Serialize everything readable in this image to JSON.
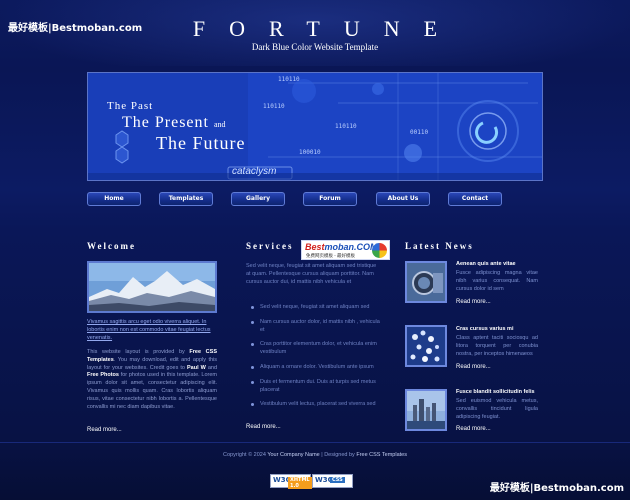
{
  "watermark": {
    "top_left": "最好模板|Bestmoban.com",
    "bottom_right": "最好模板|Bestmoban.com"
  },
  "header": {
    "title": "FORTUNE",
    "tagline": "Dark Blue Color Website Template"
  },
  "banner": {
    "line1": "The Past",
    "line2": "The Present",
    "line2_suffix": "and",
    "line3": "The Future",
    "brand": "cataclysm",
    "binary": [
      "110110",
      "110110",
      "100010",
      "00110",
      "110110"
    ]
  },
  "nav": {
    "items": [
      {
        "label": "Home",
        "active": true
      },
      {
        "label": "Templates"
      },
      {
        "label": "Gallery"
      },
      {
        "label": "Forum"
      },
      {
        "label": "About Us"
      },
      {
        "label": "Contact"
      }
    ]
  },
  "welcome": {
    "heading": "Welcome",
    "caption": "Vivamus sagittis arcu eget odio viverra aliquet. In lobortis enim non est commodo vitae feugiat lectus venenatis.",
    "body_intro": "This website layout is provided by",
    "body_link1": "Free CSS Templates",
    "body_mid1": ". You may download, edit and apply this layout for your websites. Credit goes to",
    "body_link2": "Paul W",
    "body_mid2": "and",
    "body_link3": "Free Photos",
    "body_end": "for photos used in this template. Lorem ipsum dolor sit amet, consectetur adipiscing elit. Vivamus quis mollis quam. Cras lobortis aliquam risus, vitae consectetur nibh lobortis a. Pellentesque convallis mi nec diam dapibus vitae.",
    "read_more": "Read more..."
  },
  "services": {
    "heading": "Services",
    "logo_brand_a": "Best",
    "logo_brand_b": "moban.COM",
    "logo_sub": "免费网页模板 - 最好模板",
    "intro": "Sed velit neque, feugiat sit amet aliquam sed tristique at quam. Pellentesque cursus aliquam porttitor. Nam cursus auctor dui, id mattis nibh vehicula et",
    "items": [
      "Sed velit neque, feugiat sit amet aliquam sed",
      "Nam cursus auctor dolor, id mattis nibh , vehicula et",
      "Cras porttitor elementum dolor, et vehicula enim vestibulum",
      "Aliquam a ornare dolor. Vestibulum ante ipsum",
      "Duis et fermentum dui. Duis at turpis sed metus placerat",
      "Vestibulum velit lectus, placerat sed viverra sed"
    ],
    "read_more": "Read more..."
  },
  "news": {
    "heading": "Latest News",
    "items": [
      {
        "title": "Aenean quis ante vitae",
        "body": "Fusce adipiscing magna vitae nibh varius consequat. Nam cursus dolor id sem",
        "read_more": "Read more..."
      },
      {
        "title": "Cras cursus varius mi",
        "body": "Class aptent taciti sociosqu ad litora torquent per conubia nostra, per inceptos himenaeos",
        "read_more": "Read more..."
      },
      {
        "title": "Fusce blandit sollicitudin felis",
        "body": "Sed euismod vehicula metus, convallis tincidunt ligula adipiscing feugiat.",
        "read_more": "Read more..."
      }
    ]
  },
  "footer": {
    "prefix": "Copyright © 2024",
    "company": "Your Company Name",
    "sep": "| Designed by",
    "designer": "Free CSS Templates",
    "badges": [
      {
        "logo": "W3C",
        "tag": "XHTML 1.0"
      },
      {
        "logo": "W3C",
        "tag": "CSS"
      }
    ]
  }
}
